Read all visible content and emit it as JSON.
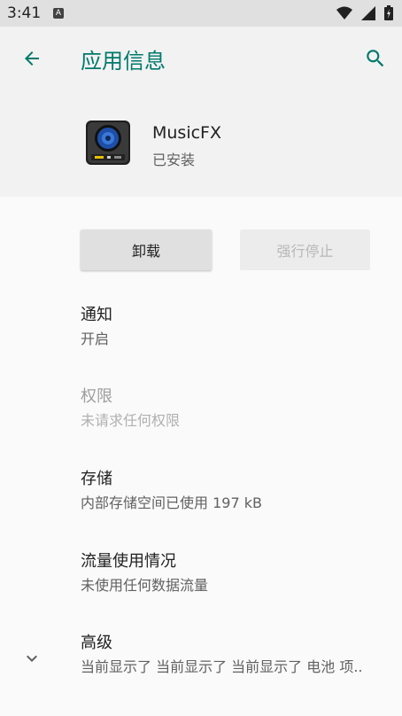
{
  "status_bar": {
    "time": "3:41",
    "notification_icon_letter": "A"
  },
  "app_bar": {
    "title": "应用信息"
  },
  "app": {
    "name": "MusicFX",
    "status": "已安装"
  },
  "buttons": {
    "uninstall": "卸载",
    "force_stop": "强行停止"
  },
  "items": [
    {
      "title": "通知",
      "summary": "开启"
    },
    {
      "title": "权限",
      "summary": "未请求任何权限"
    },
    {
      "title": "存储",
      "summary": "内部存储空间已使用 197 kB"
    },
    {
      "title": "流量使用情况",
      "summary": "未使用任何数据流量"
    },
    {
      "title": "高级",
      "summary": "当前显示了 当前显示了 当前显示了 电池 项.."
    }
  ],
  "colors": {
    "accent": "#00796b",
    "status_bar": "#e0e0e0",
    "header": "#f2f2f2",
    "background": "#fafafa"
  },
  "icons": [
    "arrow-back-icon",
    "search-icon",
    "wifi-icon",
    "signal-icon",
    "battery-icon",
    "chevron-down-icon"
  ]
}
